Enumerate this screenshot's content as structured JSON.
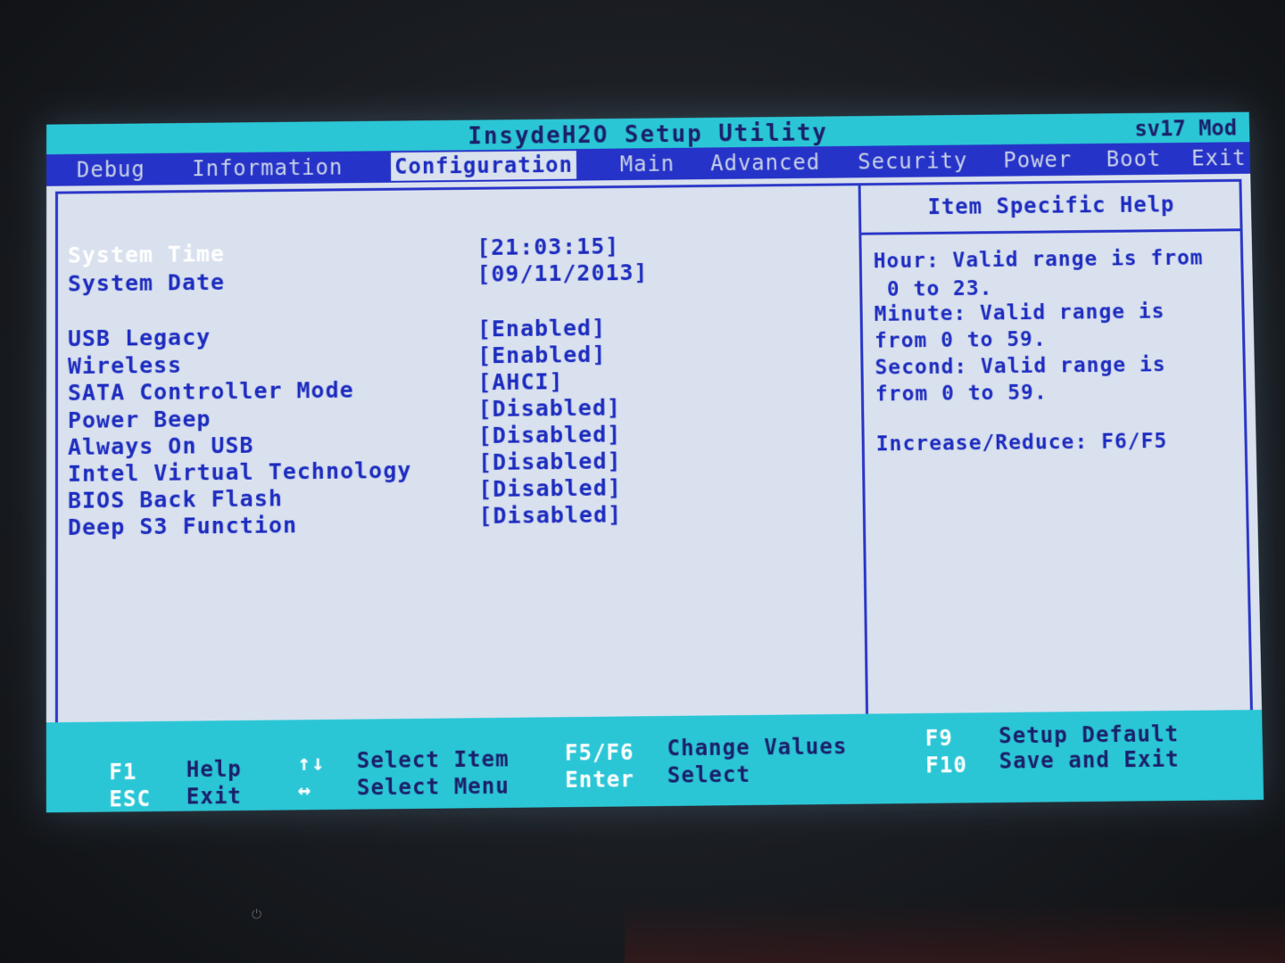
{
  "title": "InsydeH2O Setup Utility",
  "model": "sv17 Mod",
  "menu": [
    {
      "label": "Debug",
      "active": false
    },
    {
      "label": "Information",
      "active": false
    },
    {
      "label": "Configuration",
      "active": true
    },
    {
      "label": "Main",
      "active": false
    },
    {
      "label": "Advanced",
      "active": false
    },
    {
      "label": "Security",
      "active": false
    },
    {
      "label": "Power",
      "active": false
    },
    {
      "label": "Boot",
      "active": false
    },
    {
      "label": "Exit",
      "active": false
    }
  ],
  "settings": [
    {
      "label": "System Time",
      "value": "[21:03:15]"
    },
    {
      "label": "System Date",
      "value": "[09/11/2013]"
    },
    {
      "label": "USB Legacy",
      "value": "[Enabled]"
    },
    {
      "label": "Wireless",
      "value": "[Enabled]"
    },
    {
      "label": "SATA Controller Mode",
      "value": "[AHCI]"
    },
    {
      "label": "Power Beep",
      "value": "[Disabled]"
    },
    {
      "label": "Always On USB",
      "value": "[Disabled]"
    },
    {
      "label": "Intel Virtual Technology",
      "value": "[Disabled]"
    },
    {
      "label": "BIOS Back Flash",
      "value": "[Disabled]"
    },
    {
      "label": "Deep S3 Function",
      "value": "[Disabled]"
    }
  ],
  "help": {
    "title": "Item Specific Help",
    "lines": [
      "Hour: Valid range is from",
      " 0 to 23.",
      "Minute: Valid range is",
      "from 0 to 59.",
      "Second: Valid range is",
      "from 0 to 59.",
      "Increase/Reduce: F6/F5"
    ]
  },
  "footer": {
    "f1_key": "F1",
    "f1_label": "Help",
    "esc_key": "ESC",
    "esc_label": "Exit",
    "updown_key": "↑↓",
    "updown_label": "Select Item",
    "leftright_key": "↔",
    "leftright_label": "Select Menu",
    "f5f6_key": "F5/F6",
    "f5f6_label": "Change Values",
    "enter_key": "Enter",
    "enter_label": "Select",
    "f9_key": "F9",
    "f9_label": "Setup Default",
    "f10_key": "F10",
    "f10_label": "Save and Exit"
  }
}
